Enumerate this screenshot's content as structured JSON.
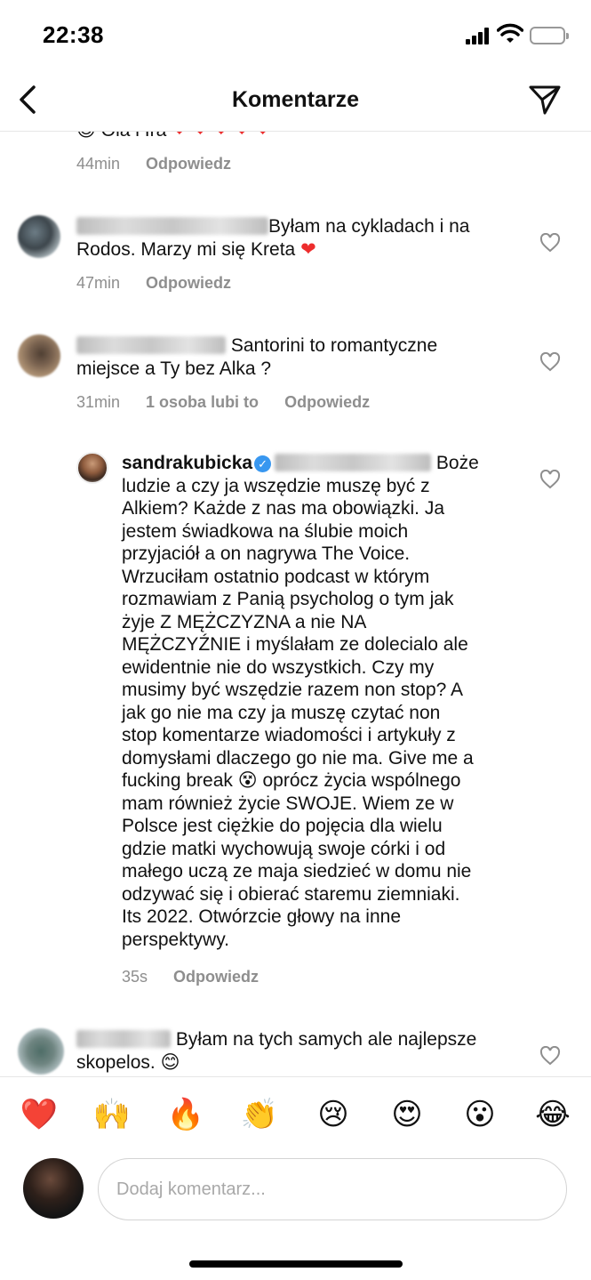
{
  "status_bar": {
    "time": "22:38"
  },
  "header": {
    "title": "Komentarze"
  },
  "top_partial": {
    "text": "Ola i Ira",
    "meta": {
      "time": "44min",
      "reply": "Odpowiedz"
    }
  },
  "comments": [
    {
      "text_line1": "Byłam na cykladach i na",
      "text_line2": "Rodos. Marzy mi się Kreta",
      "meta": {
        "time": "47min",
        "reply": "Odpowiedz"
      }
    },
    {
      "text_line1": "Santorini to romantyczne",
      "text_line2": "miejsce a Ty bez Alka ?",
      "meta": {
        "time": "31min",
        "likes": "1 osoba lubi to",
        "reply": "Odpowiedz"
      }
    },
    {
      "username": "sandrakubicka",
      "first_line_suffix": "Boże",
      "lines": [
        "ludzie a czy ja wszędzie muszę być z",
        "Alkiem? Każde z nas ma obowiązki. Ja",
        "jestem świadkowa na ślubie moich",
        "przyjaciół a on nagrywa The Voice.",
        "Wrzuciłam ostatnio podcast w którym",
        "rozmawiam z Panią psycholog o tym jak",
        "żyje Z MĘŻCZYZNA a nie NA",
        "MĘŻCZYŹNIE i myślałam ze dolecialo ale",
        "ewidentnie nie do wszystkich. Czy my",
        "musimy być wszędzie razem non stop? A",
        "jak go nie ma czy ja muszę czytać non",
        "stop komentarze wiadomości i artykuły z",
        "domysłami dlaczego go nie ma. Give me a",
        "fucking break",
        "mam również życie SWOJE. Wiem ze w",
        "Polsce jest ciężkie do pojęcia dla wielu",
        "gdzie matki wychowują swoje córki i od",
        "małego uczą ze maja siedzieć w domu nie",
        "odzywać się i obierać staremu ziemniaki.",
        "Its 2022. Otwórzcie głowy na inne",
        "perspektywy."
      ],
      "break_line_suffix": "oprócz życia wspólnego",
      "meta": {
        "time": "35s",
        "reply": "Odpowiedz"
      }
    },
    {
      "text_line1": "Byłam na tych samych ale najlepsze",
      "text_line2": "skopelos."
    }
  ],
  "emoji_bar": [
    "❤️",
    "🙌",
    "🔥",
    "👏",
    "😢",
    "😍",
    "😮",
    "😂"
  ],
  "composer": {
    "placeholder": "Dodaj komentarz..."
  },
  "colors": {
    "heart": "#ed2d2d",
    "verified": "#3897f0",
    "meta_text": "#8e8e8e"
  }
}
